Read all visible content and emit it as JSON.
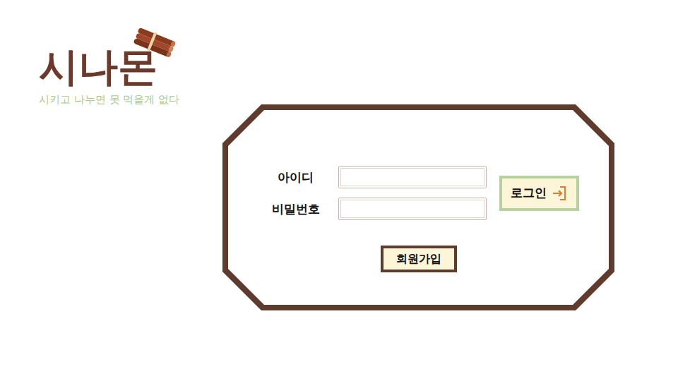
{
  "logo": {
    "title": "시나몬",
    "tagline": "시키고 나누면 못 먹을게 없다"
  },
  "form": {
    "fields": [
      {
        "label": "아이디",
        "value": ""
      },
      {
        "label": "비밀번호",
        "value": ""
      }
    ],
    "login_button": "로그인",
    "signup_button": "회원가입"
  }
}
